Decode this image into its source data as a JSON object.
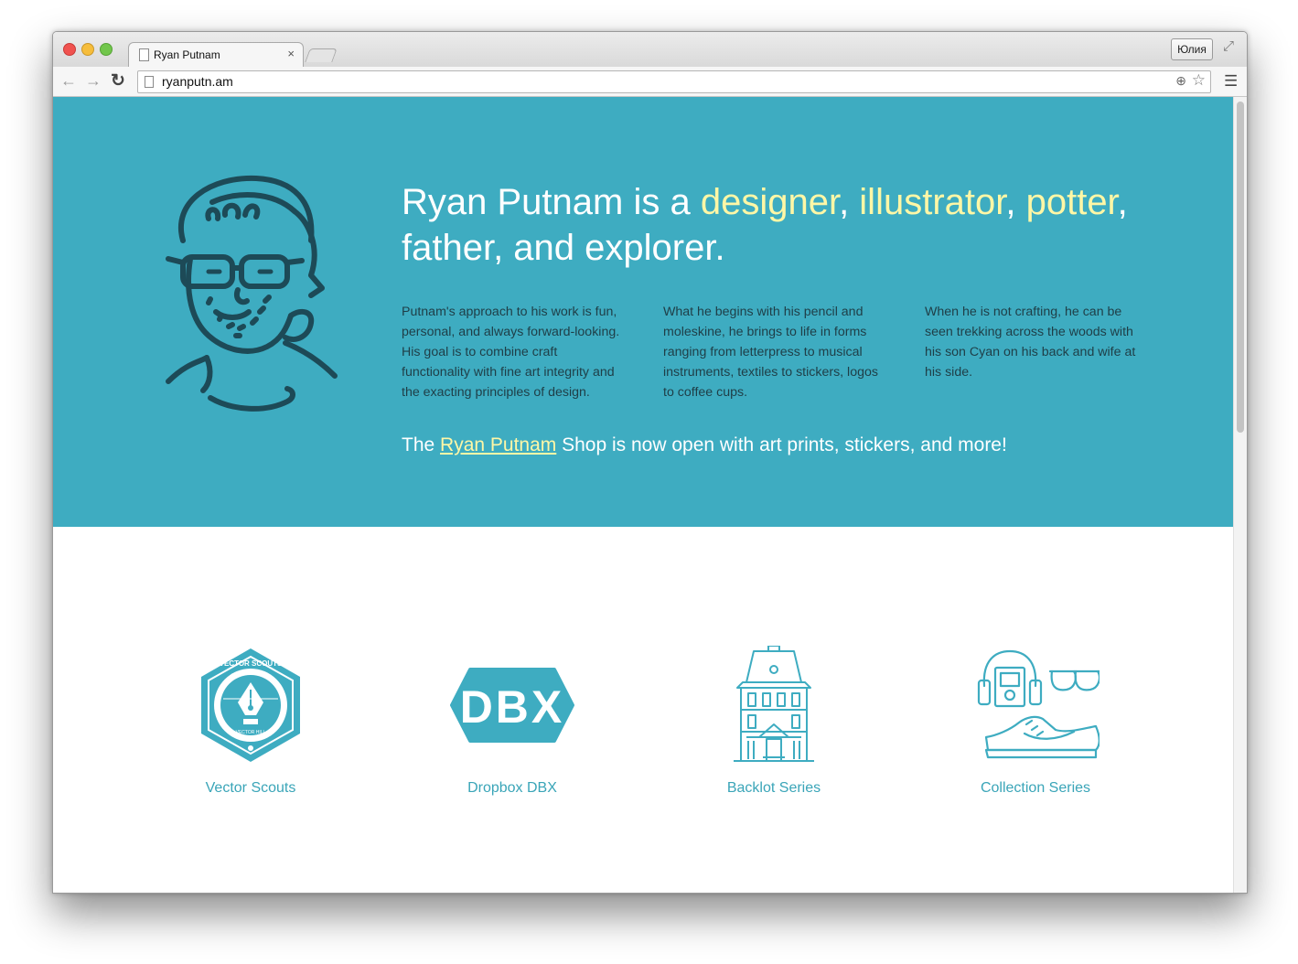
{
  "browser": {
    "tab_title": "Ryan Putnam",
    "tab_close": "×",
    "user_button": "Юлия",
    "url": "ryanputn.am",
    "icons": [
      "back-arrow-icon",
      "forward-arrow-icon",
      "reload-icon",
      "page-icon",
      "zoom-icon",
      "star-icon",
      "menu-icon",
      "fullscreen-icon"
    ]
  },
  "colors": {
    "hero_bg": "#3eacc1",
    "highlight": "#fff7a6",
    "body_text": "#1f3e47",
    "accent": "#3aa5b8"
  },
  "hero": {
    "headline": {
      "prefix": "Ryan Putnam is a ",
      "role1": "designer",
      "sep1": ", ",
      "role2": "illustrator",
      "sep2": ", ",
      "role3": "potter",
      "suffix": ", father, and explorer."
    },
    "col1": "Putnam's approach to his work is fun, personal, and always forward-looking. His goal is to combine craft functionality with fine art integrity and the exacting principles of design.",
    "col2": "What he begins with his pencil and moleskine, he brings to life in forms ranging from letterpress to musical instruments, textiles to stickers, logos to coffee cups.",
    "col3": "When he is not crafting, he can be seen trekking across the woods with his son Cyan on his back and wife at his side.",
    "shop": {
      "prefix": "The ",
      "link": "Ryan Putnam",
      "suffix": " Shop is now open with art prints, stickers, and more!"
    }
  },
  "projects": [
    {
      "label": "Vector Scouts",
      "badge_text": "VECTOR SCOUTS",
      "badge_sub": "VECTOR HILL",
      "icon": "vector-scouts-badge-icon"
    },
    {
      "label": "Dropbox DBX",
      "badge_text": "DBX",
      "icon": "dbx-hexagon-icon"
    },
    {
      "label": "Backlot Series",
      "icon": "victorian-house-icon"
    },
    {
      "label": "Collection Series",
      "icon": "headphones-sunglasses-sneaker-icon"
    }
  ]
}
